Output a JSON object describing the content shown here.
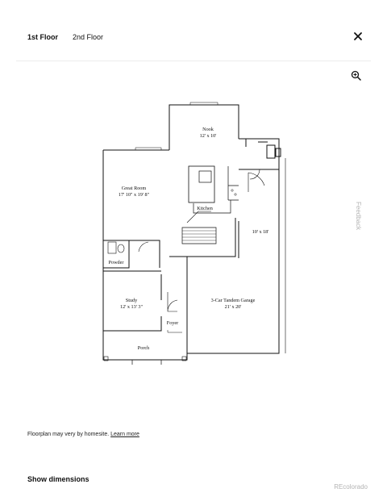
{
  "tabs": [
    {
      "label": "1st Floor",
      "active": true
    },
    {
      "label": "2nd Floor",
      "active": false
    }
  ],
  "icons": {
    "close": "close-icon",
    "zoom": "zoom-in-icon"
  },
  "feedback_label": "Feedback",
  "floorplan": {
    "rooms": [
      {
        "name": "Nook",
        "size": "12' x 10'"
      },
      {
        "name": "Great Room",
        "size": "17' 10\" x 19' 8\""
      },
      {
        "name": "Kitchen",
        "size": ""
      },
      {
        "name": "",
        "size": "10' x 18'"
      },
      {
        "name": "Powder",
        "size": ""
      },
      {
        "name": "Study",
        "size": "12' x 13' 3\""
      },
      {
        "name": "3-Car Tandem Garage",
        "size": "21' x 20'"
      },
      {
        "name": "Foyer",
        "size": ""
      },
      {
        "name": "Porch",
        "size": ""
      }
    ]
  },
  "note": {
    "text": "Floorplan may very by homesite.",
    "link": "Learn more"
  },
  "show_dimensions_label": "Show dimensions",
  "brand": "REcolorado"
}
